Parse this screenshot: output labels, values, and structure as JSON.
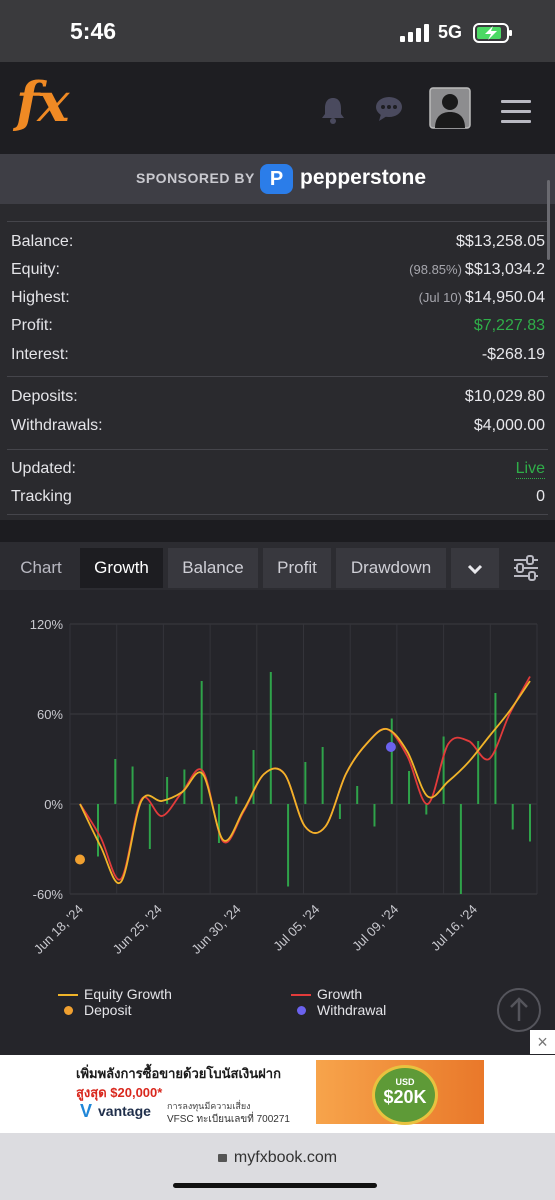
{
  "status_bar": {
    "time": "5:46",
    "network": "5G"
  },
  "header": {
    "logo": "fx",
    "icons": [
      "bell-icon",
      "chat-icon",
      "user-avatar-icon",
      "hamburger-menu-icon"
    ]
  },
  "sponsor": {
    "label": "SPONSORED BY",
    "logo_letter": "P",
    "name": "pepperstone"
  },
  "stats": {
    "balance_label": "Balance:",
    "balance_value": "$$13,258.05",
    "equity_label": "Equity:",
    "equity_note": "(98.85%)",
    "equity_value": "$$13,034.2",
    "highest_label": "Highest:",
    "highest_note": "(Jul 10)",
    "highest_value": "$14,950.04",
    "profit_label": "Profit:",
    "profit_value": "$7,227.83",
    "interest_label": "Interest:",
    "interest_value": "-$268.19",
    "deposits_label": "Deposits:",
    "deposits_value": "$10,029.80",
    "withdrawals_label": "Withdrawals:",
    "withdrawals_value": "$4,000.00",
    "updated_label": "Updated:",
    "updated_value": "Live",
    "tracking_label": "Tracking",
    "tracking_value": "0"
  },
  "tabs": {
    "chart": "Chart",
    "growth": "Growth",
    "balance": "Balance",
    "profit": "Profit",
    "drawdown": "Drawdown",
    "active": "Growth"
  },
  "chart_data": {
    "type": "line",
    "y_ticks": [
      "120%",
      "60%",
      "0%",
      "-60%"
    ],
    "ylim": [
      -60,
      120
    ],
    "x_labels": [
      "Jun 18, '24",
      "Jun 25, '24",
      "Jun 30, '24",
      "Jul 05, '24",
      "Jul 09, '24",
      "Jul 16, '24"
    ],
    "x_index": [
      0,
      1,
      2,
      3,
      4,
      5,
      6,
      7,
      8,
      9,
      10,
      11,
      12,
      13,
      14,
      15,
      16,
      17,
      18,
      19,
      20,
      21,
      22
    ],
    "series": [
      {
        "name": "Growth",
        "color": "#e23b3b",
        "values": [
          0,
          -22,
          -50,
          3,
          -8,
          8,
          22,
          -25,
          -5,
          20,
          20,
          -15,
          -15,
          20,
          40,
          50,
          32,
          0,
          40,
          42,
          30,
          60,
          85
        ]
      },
      {
        "name": "Equity Growth",
        "color": "#f0b429",
        "values": [
          0,
          -28,
          -52,
          2,
          2,
          8,
          20,
          -24,
          -4,
          20,
          20,
          -15,
          -15,
          20,
          40,
          50,
          35,
          5,
          15,
          28,
          45,
          62,
          82
        ]
      }
    ],
    "volume_bars": [
      -35,
      30,
      25,
      -30,
      18,
      23,
      82,
      -26,
      5,
      36,
      88,
      -55,
      28,
      38,
      -10,
      12,
      -15,
      57,
      22,
      -7,
      45,
      -60,
      42,
      74,
      -17,
      -25
    ],
    "deposit_points": [
      {
        "x": 0,
        "y": -37
      }
    ],
    "withdrawal_points": [
      {
        "x": 15.2,
        "y": 38
      }
    ],
    "legend": [
      {
        "label": "Equity Growth",
        "kind": "line",
        "color": "#f0b429"
      },
      {
        "label": "Growth",
        "kind": "line",
        "color": "#e23b3b"
      },
      {
        "label": "Deposit",
        "kind": "dot",
        "color": "#f0a030"
      },
      {
        "label": "Withdrawal",
        "kind": "dot",
        "color": "#6b62ee"
      }
    ],
    "grid": true
  },
  "ad": {
    "line1": "เพิ่มพลังการซื้อขายด้วยโบนัสเงินฝาก",
    "line2": "สูงสุด $20,000*",
    "brand_mark": "V",
    "brand": "vantage",
    "note1": "การลงทุนมีความเสี่ยง",
    "note2": "VFSC ทะเบียนเลขที่ 700271",
    "coin_top": "USD",
    "coin_value": "$20K",
    "close": "×"
  },
  "url": {
    "domain": "myfxbook.com"
  }
}
